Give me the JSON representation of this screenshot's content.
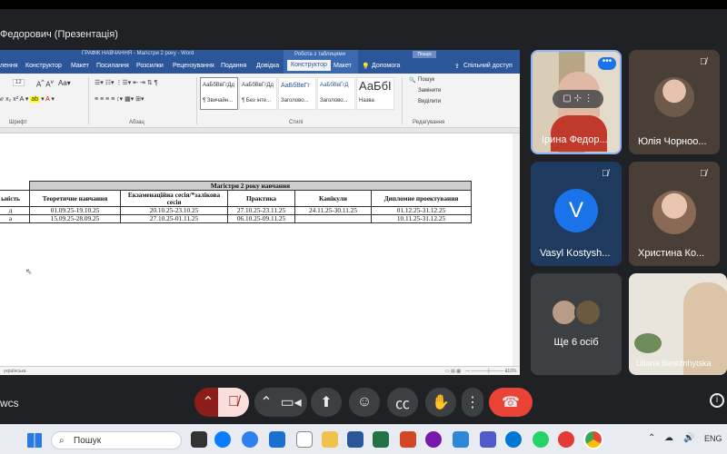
{
  "meeting": {
    "presenter_title": "Федорович (Презентація)",
    "meeting_code": "wcs"
  },
  "word": {
    "title": "ГРАФІК НАВЧАННЯ - Магістри 2 року - Word",
    "search_label": "Пошук",
    "context_tab": "Робота з таблицями",
    "tabs": [
      "лення",
      "Конструктор",
      "Макет",
      "Посилання",
      "Розсилки",
      "Рецензування",
      "Подання",
      "Довідка",
      "Конструктор",
      "Макет"
    ],
    "help": "Допомога",
    "share_label": "Спільний доступ",
    "font_size": "12",
    "groups": [
      "Шрифт",
      "Абзац",
      "Стилі",
      "Редагування"
    ],
    "styles": [
      {
        "preview": "АаБбВвГгДд",
        "name": "¶ Звичайн..."
      },
      {
        "preview": "АаБбВвГгДд",
        "name": "¶ Без інте..."
      },
      {
        "preview": "АаБбВвГг",
        "name": "Заголово..."
      },
      {
        "preview": "АаБбВвГгД",
        "name": "Заголово..."
      },
      {
        "preview": "АаБбІ",
        "name": "Назва"
      }
    ],
    "editing": [
      "Пошук",
      "Замінити",
      "Виділити"
    ],
    "status_lang": "українська",
    "zoom": "110%"
  },
  "table": {
    "caption": "Магістри 2 року навчання",
    "headers": [
      "ьність",
      "Теоретичне навчання",
      "Екзаменаційна сесія/*залікова сесія",
      "Практика",
      "Канікули",
      "Дипломне проектування"
    ],
    "rows": [
      [
        "д",
        "01.09.25-19.10.25",
        "20.10.25-23.10.25",
        "27.10.25-23.11.25",
        "24.11.25-30.11.25",
        "01.12.25-31.12.25"
      ],
      [
        "а",
        "15.09.25-28.09.25",
        "27.10.25-01.11.25",
        "06.10.25-09.11.25",
        "",
        "10.11.25-31.12.25"
      ]
    ]
  },
  "participants": [
    {
      "name": "Ірина Федор...",
      "avatar": "woman-with-glasses-photo"
    },
    {
      "name": "Юлія Чорноо...",
      "avatar": "woman-photo",
      "muted": true
    },
    {
      "name": "Vasyl Kostysh...",
      "avatar_letter": "V",
      "muted": true
    },
    {
      "name": "Христина Ко...",
      "avatar": "woman-photo",
      "muted": true
    },
    {
      "name": "Ще 6 осіб",
      "avatar": "two-avatars"
    },
    {
      "name": "Uliana Bereznhytska",
      "avatar": "woman-video"
    }
  ],
  "taskbar": {
    "search_placeholder": "Пошук",
    "lang": "ENG"
  },
  "colors": {
    "word_blue": "#2b579a",
    "meet_bg": "#202124",
    "tile_bg": "#3c4043",
    "end_call": "#ea4335",
    "avatar_v": "#1a73e8",
    "mic_off_red": "#8c1d18"
  }
}
